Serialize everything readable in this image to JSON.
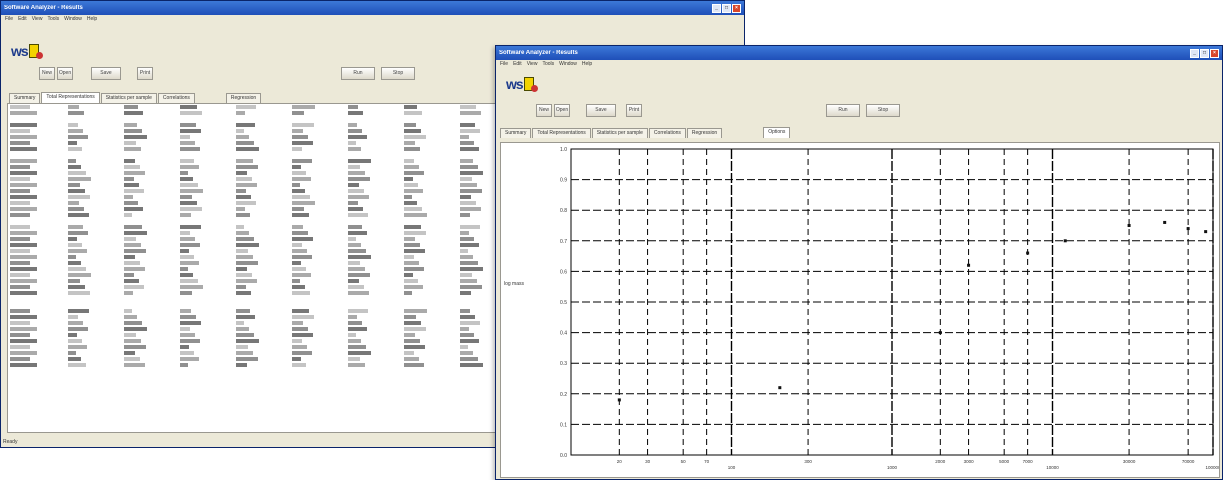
{
  "app": {
    "title": "Software Analyzer - Results"
  },
  "menu": [
    "File",
    "Edit",
    "View",
    "Tools",
    "Window",
    "Help"
  ],
  "logo": {
    "text": "ws"
  },
  "toolbar": {
    "buttons": [
      "New",
      "Open",
      "Save",
      "Print"
    ],
    "right_buttons": [
      "Run",
      "Stop"
    ]
  },
  "window1": {
    "tabs": [
      "Summary",
      "Total Representations",
      "Statistics per sample",
      "Correlations",
      "Regression"
    ],
    "active_tab": 1,
    "status": "Ready"
  },
  "window2": {
    "tabs": [
      "Summary",
      "Total Representations",
      "Statistics per sample",
      "Correlations",
      "Regression",
      "Options"
    ],
    "active_tab": 5,
    "ylabel": "log mass"
  },
  "colors": {
    "titlebar": "#1f4fb8",
    "window_bg": "#ece9d8",
    "panel_border": "#9a9890",
    "gridline": "#000000"
  },
  "chart_data": {
    "type": "scatter",
    "title": "",
    "xlabel": "",
    "ylabel": "log mass",
    "xscale": "log",
    "xlim": [
      10,
      100000
    ],
    "ylim": [
      0.0,
      1.0
    ],
    "y_ticks": [
      "1.0",
      "0.9",
      "0.8",
      "0.7",
      "0.6",
      "0.5",
      "0.4",
      "0.3",
      "0.2",
      "0.1",
      "0.0"
    ],
    "x_ticks": [
      "20",
      "30",
      "50",
      "70",
      "100",
      "300",
      "1000",
      "2000",
      "3000",
      "5000",
      "7000",
      "10000",
      "30000",
      "70000",
      "100000"
    ],
    "x_major_ticks": [
      "100",
      "1000",
      "10000",
      "100000"
    ],
    "series": [
      {
        "x": [
          20,
          200,
          2000,
          3000,
          7000,
          12000,
          30000,
          50000,
          70000,
          90000
        ],
        "y": [
          0.18,
          0.22,
          0.4,
          0.62,
          0.66,
          0.7,
          0.75,
          0.76,
          0.74,
          0.73
        ]
      }
    ],
    "grid": true
  }
}
